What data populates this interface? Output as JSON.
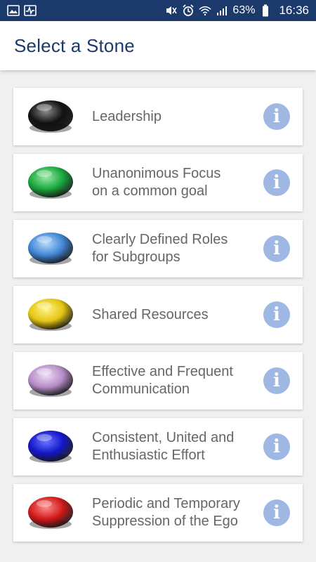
{
  "status_bar": {
    "left_icons": [
      "image-icon",
      "activity-icon"
    ],
    "right_icons": [
      "mute-vibrate-icon",
      "alarm-icon",
      "wifi-icon",
      "signal-icon",
      "battery-icon"
    ],
    "battery_percent": "63%",
    "time": "16:36"
  },
  "header": {
    "title": "Select a Stone"
  },
  "stones": [
    {
      "line1": "Leadership",
      "line2": "",
      "color": "#111111",
      "highlight": "#8c8c8c"
    },
    {
      "line1": "Unanonimous Focus",
      "line2": "on a common goal",
      "color": "#18a83c",
      "highlight": "#9be8a8"
    },
    {
      "line1": "Clearly Defined Roles",
      "line2": "for Subgroups",
      "color": "#3f86d6",
      "highlight": "#b8dcfa"
    },
    {
      "line1": "Shared Resources",
      "line2": "",
      "color": "#e5c410",
      "highlight": "#fff58a"
    },
    {
      "line1": "Effective and Frequent",
      "line2": "Communication",
      "color": "#b48cc6",
      "highlight": "#efdcf6"
    },
    {
      "line1": "Consistent, United and",
      "line2": "Enthusiastic Effort",
      "color": "#1216c8",
      "highlight": "#6c74ff"
    },
    {
      "line1": "Periodic and Temporary",
      "line2": "Suppression of the Ego",
      "color": "#d01818",
      "highlight": "#ff8a8a"
    }
  ],
  "info_icon": {
    "glyph": "i",
    "name": "info-icon",
    "color": "#9fb8e3"
  }
}
